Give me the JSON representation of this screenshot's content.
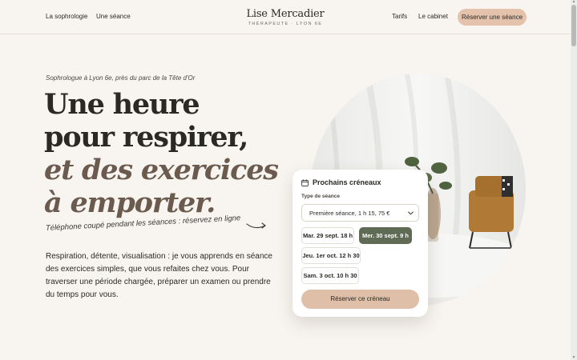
{
  "header": {
    "nav_left": [
      "La sophrologie",
      "Une séance"
    ],
    "brand_name": "Lise Mercadier",
    "brand_subtitle": "THÉRAPEUTE · LYON 6E",
    "nav_right": [
      "Tarifs",
      "Le cabinet"
    ],
    "cta_label": "Réserver une séance"
  },
  "hero": {
    "eyebrow": "Sophrologue à Lyon 6e, près du parc de la Tête d'Or",
    "headline_lines": [
      "Une heure",
      "pour respirer,",
      "et des exercices",
      "à emporter."
    ],
    "tagline": "Téléphone coupé pendant les séances : réservez en ligne",
    "lede": "Respiration, détente, visualisation : je vous apprends en séance des exercices simples, que vous refaites chez vous. Pour traverser une période chargée, préparer un examen ou prendre du temps pour vous."
  },
  "booking": {
    "title": "Prochains créneaux",
    "icon": "calendar-icon",
    "session_type_label": "Type de séance",
    "session_type_value": "Première séance, 1 h 15, 75 €",
    "slots": [
      {
        "label": "Mar. 29 sept. 18 h",
        "selected": false
      },
      {
        "label": "Mer. 30 sept. 9 h",
        "selected": true
      },
      {
        "label": "Jeu. 1er oct. 12 h 30",
        "selected": false
      },
      {
        "label": "Sam. 3 oct. 10 h 30",
        "selected": false
      }
    ],
    "submit_label": "Réserver ce créneau"
  },
  "colors": {
    "background": "#f8f5f0",
    "accent_pill": "#e4c2ac",
    "selected_slot": "#5f6b55",
    "headline_accent": "#6b5a4e"
  }
}
